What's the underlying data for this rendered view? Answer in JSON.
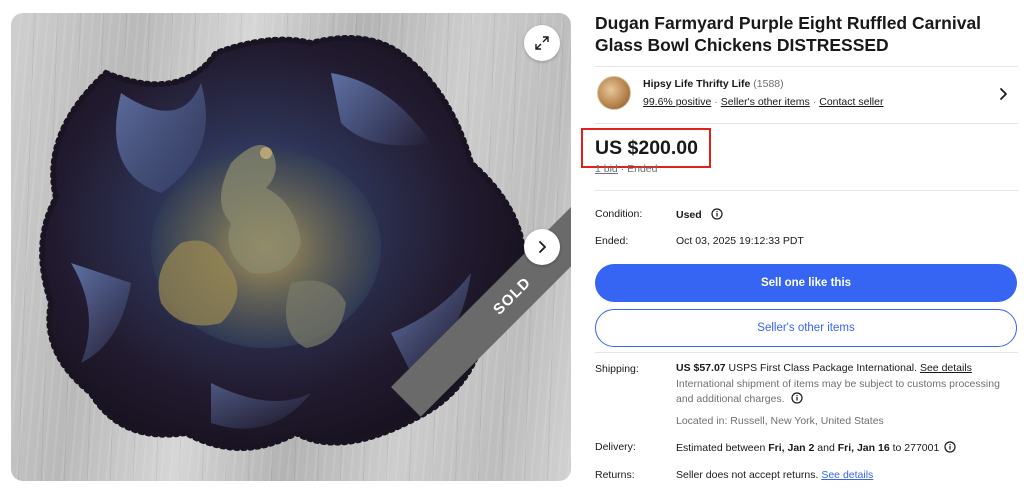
{
  "image": {
    "sold_label": "SOLD",
    "expand_icon": "expand-icon",
    "next_icon": "chevron-right-icon"
  },
  "listing": {
    "title": "Dugan Farmyard Purple Eight Ruffled Carnival Glass Bowl Chickens DISTRESSED"
  },
  "seller": {
    "name": "Hipsy Life Thrifty Life",
    "feedback_count": "(1588)",
    "positive": "99.6% positive",
    "other_items_link": "Seller's other items",
    "contact_link": "Contact seller"
  },
  "price": {
    "amount": "US $200.00",
    "bids": "1 bid",
    "sep": "·",
    "status": "Ended",
    "highlight_color": "#e0201b"
  },
  "details": {
    "condition_label": "Condition:",
    "condition_value": "Used",
    "ended_label": "Ended:",
    "ended_value": "Oct 03, 2025 19:12:33 PDT"
  },
  "actions": {
    "sell_one": "Sell one like this",
    "sellers_other_items": "Seller's other items",
    "accent_color": "#3665f3"
  },
  "shipping": {
    "label": "Shipping:",
    "cost": "US $57.07",
    "service": "USPS First Class Package International.",
    "see_details": "See details",
    "note": "International shipment of items may be subject to customs processing and additional charges.",
    "location": "Located in: Russell, New York, United States"
  },
  "delivery": {
    "label": "Delivery:",
    "prefix": "Estimated between",
    "start": "Fri, Jan 2",
    "and": "and",
    "end": "Fri, Jan 16",
    "to": "to 277001"
  },
  "returns": {
    "label": "Returns:",
    "text": "Seller does not accept returns.",
    "see_details": "See details"
  }
}
